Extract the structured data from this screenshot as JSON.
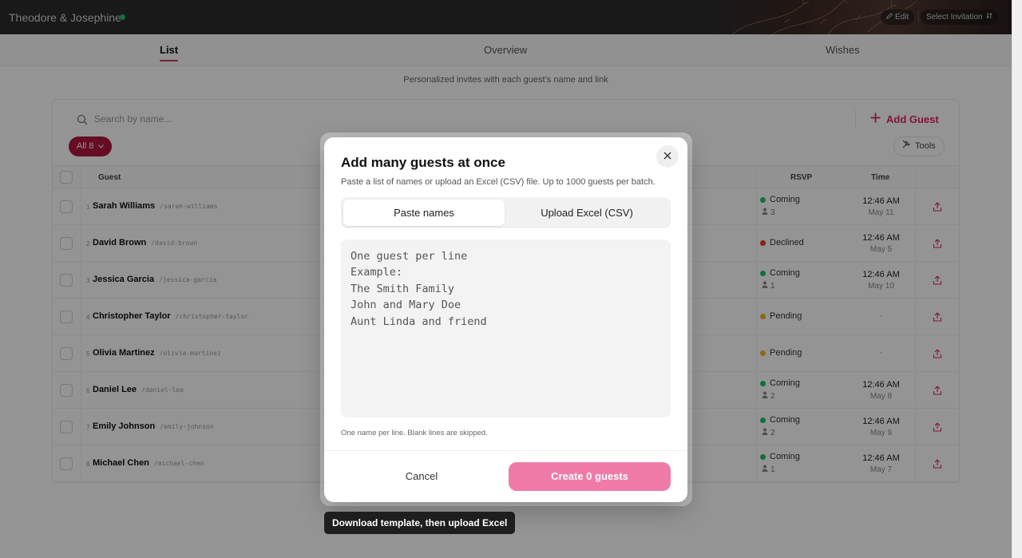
{
  "header": {
    "title": "Theodore & Josephine",
    "edit_label": "Edit",
    "select_invitation_label": "Select Invitation"
  },
  "tabs": [
    {
      "label": "List",
      "active": true
    },
    {
      "label": "Overview",
      "active": false
    },
    {
      "label": "Wishes",
      "active": false
    }
  ],
  "subtitle": "Personalized invites with each guest's name and link",
  "toolbar": {
    "search_placeholder": "Search by name...",
    "add_guest_label": "Add Guest",
    "filter_label": "All 8",
    "tools_label": "Tools"
  },
  "table": {
    "headers": {
      "guest": "Guest",
      "rsvp": "RSVP",
      "time": "Time"
    },
    "rows": [
      {
        "index": "1",
        "name": "Sarah Williams",
        "slug": "/sarah-williams",
        "rsvp": "Coming",
        "people": "3",
        "time": "12:46 AM",
        "date": "May 11"
      },
      {
        "index": "2",
        "name": "David Brown",
        "slug": "/david-brown",
        "rsvp": "Declined",
        "people": "",
        "time": "12:46 AM",
        "date": "May 5"
      },
      {
        "index": "3",
        "name": "Jessica Garcia",
        "slug": "/jessica-garcia",
        "rsvp": "Coming",
        "people": "1",
        "time": "12:46 AM",
        "date": "May 10"
      },
      {
        "index": "4",
        "name": "Christopher Taylor",
        "slug": "/christopher-taylor",
        "rsvp": "Pending",
        "people": "",
        "time": "-",
        "date": ""
      },
      {
        "index": "5",
        "name": "Olivia Martinez",
        "slug": "/olivia-martinez",
        "rsvp": "Pending",
        "people": "",
        "time": "-",
        "date": ""
      },
      {
        "index": "6",
        "name": "Daniel Lee",
        "slug": "/daniel-lee",
        "rsvp": "Coming",
        "people": "2",
        "time": "12:46 AM",
        "date": "May 8"
      },
      {
        "index": "7",
        "name": "Emily Johnson",
        "slug": "/emily-johnson",
        "rsvp": "Coming",
        "people": "2",
        "time": "12:46 AM",
        "date": "May 9"
      },
      {
        "index": "8",
        "name": "Michael Chen",
        "slug": "/michael-chen",
        "rsvp": "Coming",
        "people": "1",
        "time": "12:46 AM",
        "date": "May 7"
      }
    ]
  },
  "colors": {
    "accent": "#e0245e",
    "filter_bg": "#b0163f",
    "coming": "#1fbf6a",
    "declined": "#e53935",
    "pending": "#f0b429",
    "create_button": "#f07aa8"
  },
  "modal": {
    "title": "Add many guests at once",
    "description": "Paste a list of names or upload an Excel (CSV) file. Up to 1000 guests per batch.",
    "tab_paste": "Paste names",
    "tab_upload": "Upload Excel (CSV)",
    "textarea_placeholder": "One guest per line\nExample:\nThe Smith Family\nJohn and Mary Doe\nAunt Linda and friend",
    "helper": "One name per line. Blank lines are skipped.",
    "cancel_label": "Cancel",
    "create_label": "Create 0 guests"
  },
  "tooltip": "Download template, then upload Excel"
}
